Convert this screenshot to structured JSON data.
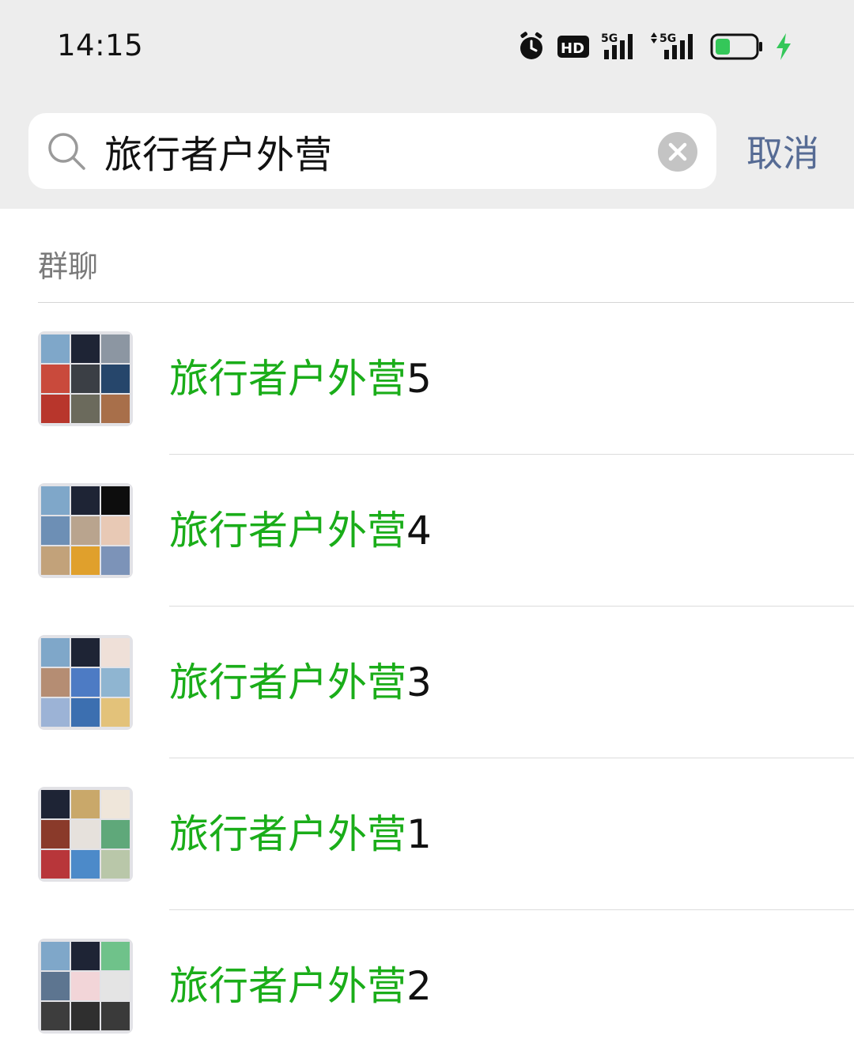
{
  "status_bar": {
    "time": "14:15",
    "icons": [
      "alarm-icon",
      "hd-voice-icon",
      "5g-signal-icon",
      "5g-signal-data-icon",
      "battery-icon",
      "charging-icon"
    ],
    "hd_label": "HD",
    "network_label_1": "5G",
    "network_label_2": "5G",
    "battery_color": "#34c759"
  },
  "search": {
    "query": "旅行者户外营",
    "cancel_label": "取消"
  },
  "section": {
    "label": "群聊"
  },
  "results": [
    {
      "match": "旅行者户外营",
      "suffix": "5"
    },
    {
      "match": "旅行者户外营",
      "suffix": "4"
    },
    {
      "match": "旅行者户外营",
      "suffix": "3"
    },
    {
      "match": "旅行者户外营",
      "suffix": "1"
    },
    {
      "match": "旅行者户外营",
      "suffix": "2"
    }
  ],
  "colors": {
    "highlight": "#1aad19",
    "cancel": "#566b94",
    "header_bg": "#ededed"
  }
}
